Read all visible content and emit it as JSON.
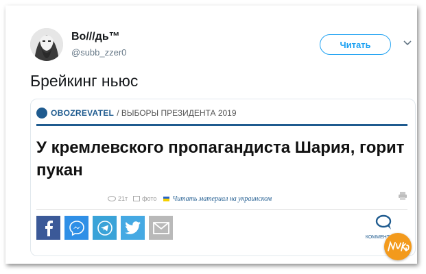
{
  "user": {
    "name": "Bo///дь™",
    "handle": "@subb_zzer0",
    "avatar_icon": "bearded-man-avatar"
  },
  "actions": {
    "follow_label": "Читать",
    "menu_icon": "chevron-down-icon"
  },
  "tweet": {
    "text": "Брейкинг ньюс"
  },
  "card": {
    "source_name": "OBOZREVATEL",
    "source_section": "/ ВЫБОРЫ ПРЕЗИДЕНТА 2019",
    "headline": "У кремлевского пропагандиста Шария, горит пукан",
    "views": "21т",
    "photo_label": "фото",
    "read_ukrainian": "Читать материал на украинском",
    "comments_label": "КОММЕНТАРИИ",
    "share_buttons": [
      {
        "name": "facebook",
        "color": "#3b5998"
      },
      {
        "name": "messenger",
        "color": "#2f8fe6"
      },
      {
        "name": "telegram",
        "color": "#3aa3d8"
      },
      {
        "name": "twitter",
        "color": "#45a9e3"
      },
      {
        "name": "email",
        "color": "#b9b9b9"
      }
    ]
  },
  "colors": {
    "accent": "#1da1f2",
    "source_blue": "#1f5b8f",
    "watermark": "#f39a1c"
  }
}
